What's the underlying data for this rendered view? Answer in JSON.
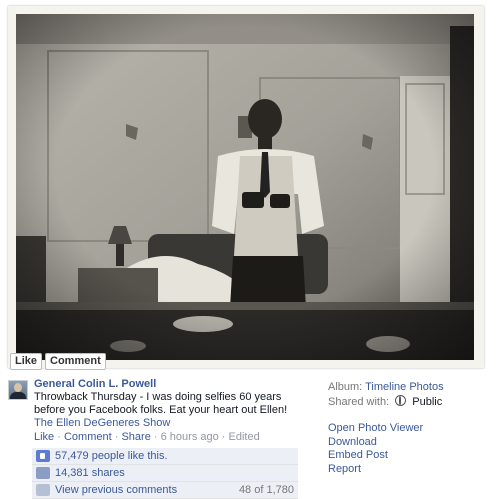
{
  "photo_buttons": {
    "like": "Like",
    "comment": "Comment"
  },
  "post": {
    "author": "General Colin L. Powell",
    "caption": "Throwback Thursday - I was doing selfies 60 years before you Facebook folks. Eat your heart out Ellen!",
    "tag": "The Ellen DeGeneres Show",
    "actions": {
      "like": "Like",
      "comment": "Comment",
      "share": "Share",
      "time": "6 hours ago",
      "edited": "Edited",
      "sep": "·"
    }
  },
  "ufi": {
    "likes": "57,479 people like this.",
    "shares": "14,381 shares",
    "view_comments": "View previous comments",
    "comment_count": "48 of 1,780"
  },
  "sidebar": {
    "album_label": "Album:",
    "album_name": "Timeline Photos",
    "shared_label": "Shared with:",
    "shared_value": "Public",
    "links": [
      "Open Photo Viewer",
      "Download",
      "Embed Post",
      "Report"
    ]
  },
  "icons": {
    "avatar": "avatar",
    "like": "thumbs-up-icon",
    "share": "share-icon",
    "comment": "comment-icon",
    "globe": "globe-icon"
  }
}
